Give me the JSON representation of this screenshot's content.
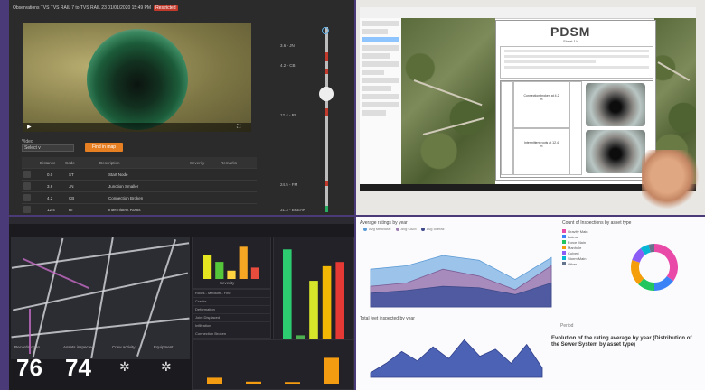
{
  "inspection": {
    "header_text": "Observations  TVS  TVS RAIL 7 to TVS RAIL 23  01/01/2020 15:49 PM",
    "badge": "Restricted",
    "select_label": "Video",
    "select_value": "Select  v",
    "action_button": "Find in map",
    "table_headers": [
      "Distance",
      "Code",
      "Description",
      "Severity",
      "Remarks"
    ],
    "rows": [
      {
        "dist": "0.0",
        "code": "ST",
        "desc": "Start Node"
      },
      {
        "dist": "3.6",
        "code": "JN",
        "desc": "Junction Smaller"
      },
      {
        "dist": "4.2",
        "code": "CB",
        "desc": "Connection Broken"
      },
      {
        "dist": "12.4",
        "code": "RI",
        "desc": "Intermittent Roots"
      }
    ],
    "axis_labels": [
      "3.6 - JN",
      "4.2 - CB",
      "12.4 - RI",
      "24.5 - FM",
      "31.3 - BREAK"
    ]
  },
  "document": {
    "logo": "PDSM",
    "subtitle": "Sheet 1/4",
    "cell_texts": [
      "Connection broken at 4.2 m",
      "Intermittent roots at 12.4 m"
    ]
  },
  "dashboard": {
    "stats": [
      {
        "label": "Records open",
        "value": "76"
      },
      {
        "label": "Assets inspected",
        "value": "74"
      }
    ],
    "icons": [
      {
        "label": "Crew activity",
        "icon": "network-icon"
      },
      {
        "label": "Equipment",
        "icon": "network-icon"
      }
    ],
    "chart_small_label": "Severity",
    "chart_large_label": "Rehab priority",
    "list_items": [
      "Roots - Medium - Fine",
      "Cracks",
      "Deformation",
      "Joint Displaced",
      "Infiltration",
      "Connection Broken",
      "Surface Damage",
      "Obstacle"
    ]
  },
  "analytics": {
    "area_title": "Average ratings by year",
    "area_legend": [
      "Avg structural",
      "Avg O&M",
      "Avg overall"
    ],
    "donut_title": "Count of Inspections by asset type",
    "donut_legend": [
      "Gravity Main",
      "Lateral",
      "Force Main",
      "Manhole",
      "Culvert",
      "Storm Main",
      "Other"
    ],
    "bottom_title": "Total feet inspected by year",
    "filter_label": "Period",
    "big_text": "Evolution of the rating average by year (Distribution of the Sewer System by asset type)"
  },
  "chart_data": [
    {
      "type": "bar",
      "values": [
        62,
        45,
        22,
        85,
        30
      ],
      "colors": [
        "#e5e520",
        "#55c53a",
        "#ffd23f",
        "#f5a623",
        "#e74c3c"
      ]
    },
    {
      "type": "bar",
      "values": [
        92,
        10,
        62,
        76,
        80
      ],
      "colors": [
        "#2ecc71",
        "#4caf50",
        "#d7e52a",
        "#f2b705",
        "#e53935"
      ]
    },
    {
      "type": "bar",
      "values": [
        15,
        5,
        4,
        65
      ],
      "colors": [
        "#f39c12",
        "#f39c12",
        "#f39c12",
        "#f39c12"
      ]
    },
    {
      "type": "area",
      "series": [
        {
          "values": [
            55,
            60,
            75,
            68,
            40,
            72
          ]
        },
        {
          "values": [
            30,
            35,
            55,
            45,
            25,
            60
          ]
        },
        {
          "values": [
            20,
            24,
            30,
            28,
            18,
            35
          ]
        }
      ]
    },
    {
      "type": "pie",
      "values": [
        35,
        15,
        12,
        18,
        10,
        6,
        4
      ],
      "colors": [
        "#e94aa8",
        "#3b82f6",
        "#22c55e",
        "#f59e0b",
        "#8b5cf6",
        "#06b6d4",
        "#64748b"
      ]
    },
    {
      "type": "area",
      "series": [
        {
          "values": [
            10,
            30,
            55,
            35,
            65,
            40,
            80,
            45,
            60,
            30,
            70,
            20
          ]
        }
      ]
    }
  ]
}
